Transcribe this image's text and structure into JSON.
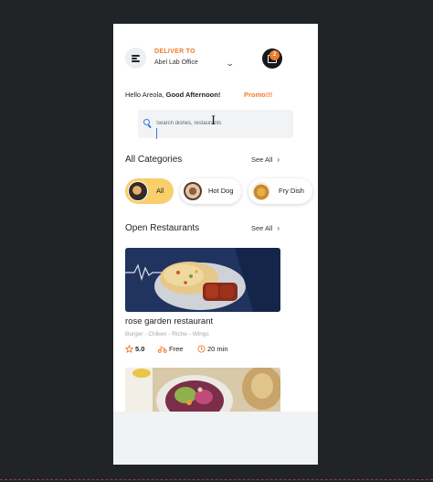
{
  "header": {
    "deliver_label": "DELIVER TO",
    "address": "Abel Lab Office",
    "cart_count": "2"
  },
  "greeting": {
    "text": "Hello Areola, ",
    "bold": "Good Afternoon!",
    "promo": "Promo!!!"
  },
  "search": {
    "placeholder": "Search dishes, restaurants"
  },
  "categories": {
    "title": "All Categories",
    "see_all": "See All",
    "items": [
      {
        "label": "All"
      },
      {
        "label": "Hot Dog"
      },
      {
        "label": "Fry Dish"
      }
    ]
  },
  "restaurants": {
    "title": "Open Restaurants",
    "see_all": "See All",
    "items": [
      {
        "name": "rose garden restaurant",
        "tags": "Burger - Chiken - Riche - Wings",
        "rating": "5.0",
        "delivery": "Free",
        "time": "20 min"
      }
    ]
  },
  "colors": {
    "accent": "#f07b2a",
    "chip_active": "#f9cf6b",
    "search_blue": "#2d7de0",
    "background": "#202426"
  },
  "icons": [
    "menu-icon",
    "chevron-down-icon",
    "cart-icon",
    "search-icon",
    "text-cursor-icon",
    "chevron-right-icon",
    "star-icon",
    "delivery-icon",
    "clock-icon"
  ]
}
